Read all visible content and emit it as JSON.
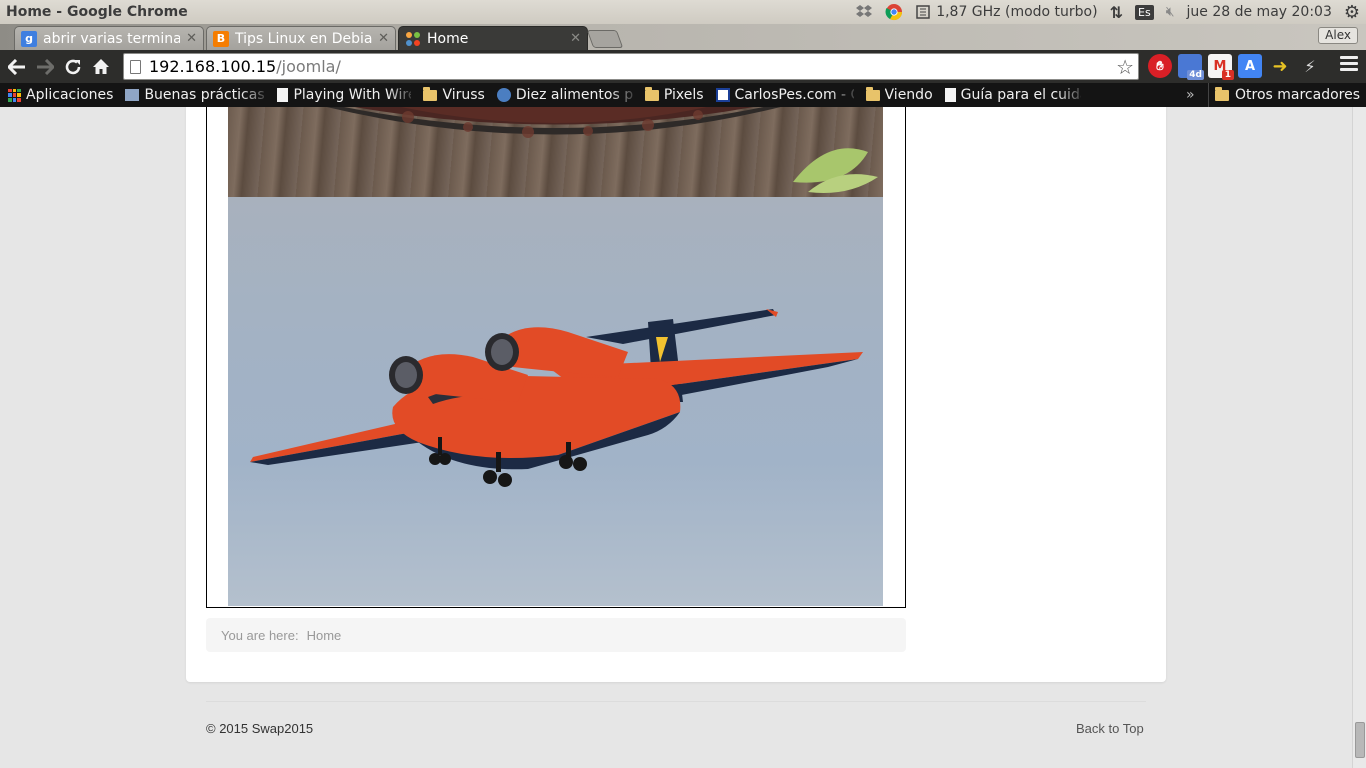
{
  "os": {
    "window_title": "Home - Google Chrome",
    "cpu": "1,87 GHz (modo turbo)",
    "keyboard": "Es",
    "datetime": "jue 28 de may 20:03"
  },
  "tabs": [
    {
      "title": "abrir varias terminal",
      "favicon": "google-g-icon",
      "color": "#3f7fe0",
      "active": false
    },
    {
      "title": "Tips Linux en Debian",
      "favicon": "blogger-icon",
      "color": "#f57d00",
      "active": false
    },
    {
      "title": "Home",
      "favicon": "joomla-icon",
      "color": "#e44d26",
      "active": true
    }
  ],
  "profile_name": "Alex",
  "address_bar": {
    "host": "192.168.100.15",
    "path": "/joomla/"
  },
  "extensions": [
    {
      "name": "adblock-icon",
      "color": "#d91f26",
      "badge": ""
    },
    {
      "name": "calendar-icon",
      "color": "#4a78d4",
      "badge": "4d"
    },
    {
      "name": "gmail-icon",
      "color": "#d93025",
      "badge": "1"
    },
    {
      "name": "translate-icon",
      "color": "#4285f4",
      "badge": ""
    },
    {
      "name": "pin-icon",
      "color": "#e7c224",
      "badge": ""
    },
    {
      "name": "flash-icon",
      "color": "#555555",
      "badge": ""
    }
  ],
  "bookmarks": {
    "apps_label": "Aplicaciones",
    "items": [
      {
        "label": "Buenas prácticas",
        "icon": "site-icon"
      },
      {
        "label": "Playing With Wire",
        "icon": "page-icon"
      },
      {
        "label": "Viruss",
        "icon": "folder-icon"
      },
      {
        "label": "Diez alimentos pa",
        "icon": "globe-icon"
      },
      {
        "label": "Pixels",
        "icon": "folder-icon"
      },
      {
        "label": "CarlosPes.com - C",
        "icon": "cp-icon"
      },
      {
        "label": "Viendo",
        "icon": "folder-icon"
      },
      {
        "label": "Guía para el cuida",
        "icon": "page-icon"
      }
    ],
    "chevron": "»",
    "other_label": "Otros marcadores"
  },
  "page": {
    "breadcrumb_prefix": "You are here:",
    "breadcrumb_current": "Home",
    "copyright": "© 2015 Swap2015",
    "back_to_top": "Back to Top"
  },
  "colors": {
    "page_bg": "#e6e6e6",
    "content_bg": "#ffffff",
    "breadcrumb_bg": "#f5f5f5",
    "plane_orange": "#ee4b1c",
    "plane_navy": "#1c2a44"
  }
}
